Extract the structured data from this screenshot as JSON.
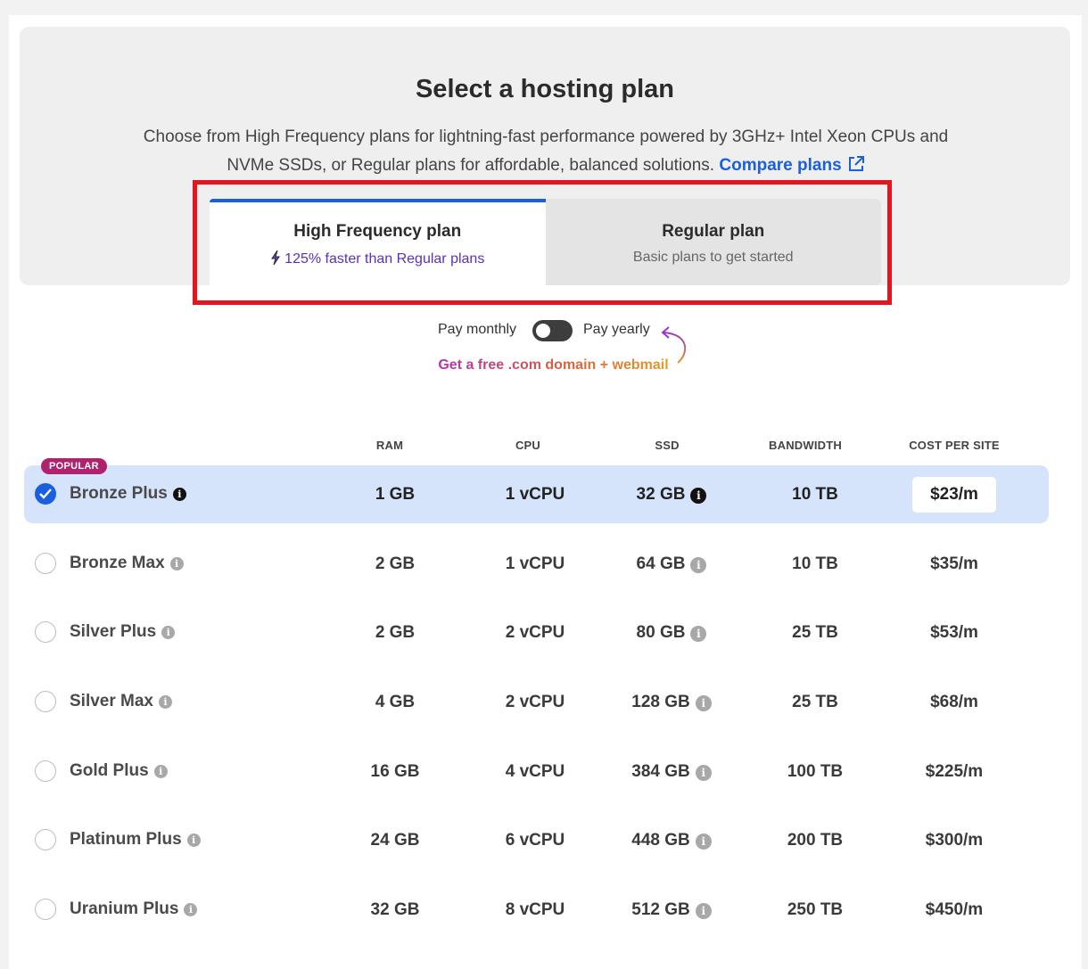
{
  "header": {
    "title": "Select a hosting plan",
    "description": "Choose from High Frequency plans for lightning-fast performance powered by 3GHz+ Intel Xeon CPUs and NVMe SSDs, or Regular plans for affordable, balanced solutions.",
    "compare_link": "Compare plans"
  },
  "tabs": {
    "high_frequency": {
      "title": "High Frequency plan",
      "subtitle": "125% faster than Regular plans"
    },
    "regular": {
      "title": "Regular plan",
      "subtitle": "Basic plans to get started"
    }
  },
  "billing": {
    "monthly_label": "Pay monthly",
    "yearly_label": "Pay yearly",
    "yearly_selected": false,
    "promo": "Get a free .com domain + webmail"
  },
  "table": {
    "columns": [
      "RAM",
      "CPU",
      "SSD",
      "BANDWIDTH",
      "COST PER SITE"
    ],
    "popular_badge": "POPULAR",
    "rows": [
      {
        "name": "Bronze Plus",
        "ram": "1 GB",
        "cpu": "1 vCPU",
        "ssd": "32 GB",
        "bandwidth": "10 TB",
        "cost": "$23/m",
        "selected": true
      },
      {
        "name": "Bronze Max",
        "ram": "2 GB",
        "cpu": "1 vCPU",
        "ssd": "64 GB",
        "bandwidth": "10 TB",
        "cost": "$35/m",
        "selected": false
      },
      {
        "name": "Silver Plus",
        "ram": "2 GB",
        "cpu": "2 vCPU",
        "ssd": "80 GB",
        "bandwidth": "25 TB",
        "cost": "$53/m",
        "selected": false
      },
      {
        "name": "Silver Max",
        "ram": "4 GB",
        "cpu": "2 vCPU",
        "ssd": "128 GB",
        "bandwidth": "25 TB",
        "cost": "$68/m",
        "selected": false
      },
      {
        "name": "Gold Plus",
        "ram": "16 GB",
        "cpu": "4 vCPU",
        "ssd": "384 GB",
        "bandwidth": "100 TB",
        "cost": "$225/m",
        "selected": false
      },
      {
        "name": "Platinum Plus",
        "ram": "24 GB",
        "cpu": "6 vCPU",
        "ssd": "448 GB",
        "bandwidth": "200 TB",
        "cost": "$300/m",
        "selected": false
      },
      {
        "name": "Uranium Plus",
        "ram": "32 GB",
        "cpu": "8 vCPU",
        "ssd": "512 GB",
        "bandwidth": "250 TB",
        "cost": "$450/m",
        "selected": false
      }
    ]
  },
  "colors": {
    "accent": "#1a5fe0",
    "selected_row": "#d6e4fb",
    "popular_badge": "#b0216e",
    "highlight_box": "#e5141e"
  }
}
